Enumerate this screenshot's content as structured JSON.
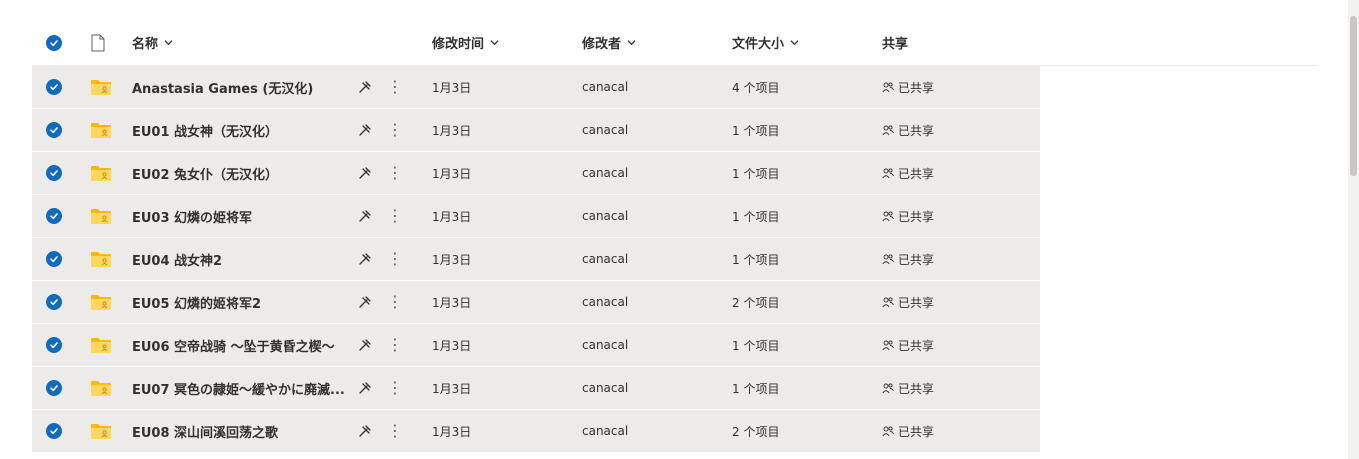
{
  "header": {
    "name_label": "名称",
    "modified_label": "修改时间",
    "modified_by_label": "修改者",
    "size_label": "文件大小",
    "share_label": "共享"
  },
  "rows": [
    {
      "name": "Anastasia Games (无汉化)",
      "date": "1月3日",
      "modified_by": "canacal",
      "size": "4 个项目",
      "share": "已共享"
    },
    {
      "name": "EU01 战女神（无汉化）",
      "date": "1月3日",
      "modified_by": "canacal",
      "size": "1 个项目",
      "share": "已共享"
    },
    {
      "name": "EU02 兔女仆（无汉化）",
      "date": "1月3日",
      "modified_by": "canacal",
      "size": "1 个项目",
      "share": "已共享"
    },
    {
      "name": "EU03 幻燐の姫将军",
      "date": "1月3日",
      "modified_by": "canacal",
      "size": "1 个项目",
      "share": "已共享"
    },
    {
      "name": "EU04 战女神2",
      "date": "1月3日",
      "modified_by": "canacal",
      "size": "1 个项目",
      "share": "已共享"
    },
    {
      "name": "EU05 幻燐的姬将军2",
      "date": "1月3日",
      "modified_by": "canacal",
      "size": "2 个项目",
      "share": "已共享"
    },
    {
      "name": "EU06 空帝战骑 ～坠于黄昏之楔～",
      "date": "1月3日",
      "modified_by": "canacal",
      "size": "1 个项目",
      "share": "已共享"
    },
    {
      "name": "EU07 冥色の隷姫～緩やかに廃滅...",
      "date": "1月3日",
      "modified_by": "canacal",
      "size": "1 个项目",
      "share": "已共享"
    },
    {
      "name": "EU08 深山间溪回荡之歌",
      "date": "1月3日",
      "modified_by": "canacal",
      "size": "2 个项目",
      "share": "已共享"
    }
  ],
  "icons": {
    "check": "check-circle-icon",
    "file_type": "document-icon",
    "folder": "shared-folder-icon",
    "action": "pin-icon",
    "more": "more-vertical-icon",
    "shared": "people-icon"
  },
  "colors": {
    "accent": "#0f6cbd",
    "row_bg": "#edebe9",
    "folder": "#ffb900"
  }
}
